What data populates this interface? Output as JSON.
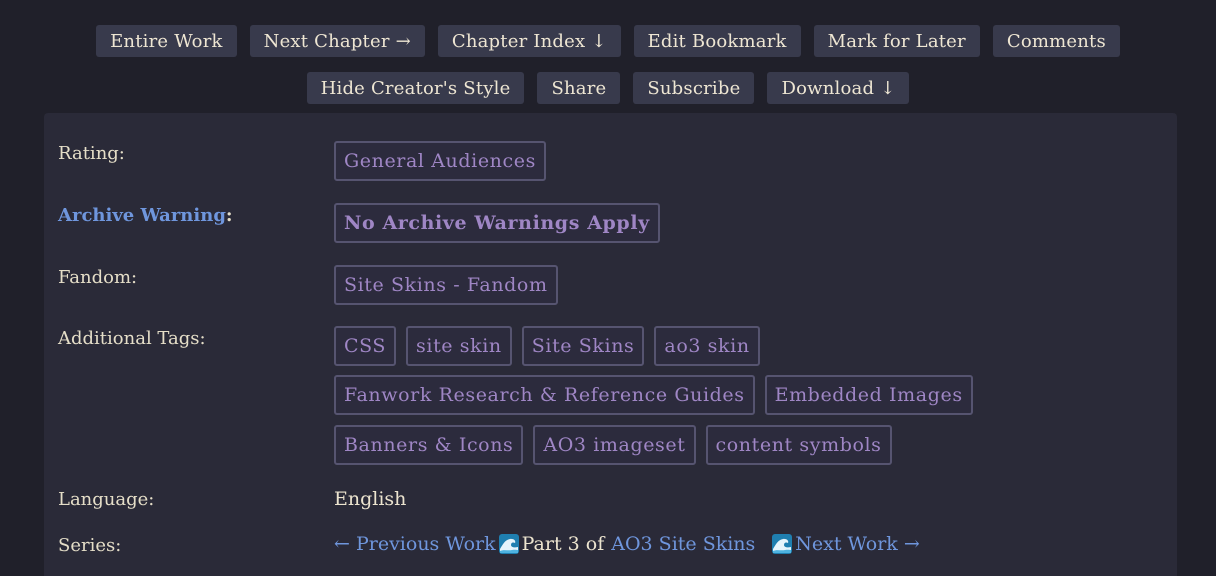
{
  "actions": {
    "row1": [
      {
        "label": "Entire Work"
      },
      {
        "label": "Next Chapter →"
      },
      {
        "label": "Chapter Index ↓"
      },
      {
        "label": "Edit Bookmark"
      },
      {
        "label": "Mark for Later"
      },
      {
        "label": "Comments"
      }
    ],
    "row2": [
      {
        "label": "Hide Creator's Style"
      },
      {
        "label": "Share"
      },
      {
        "label": "Subscribe"
      },
      {
        "label": "Download ↓"
      }
    ]
  },
  "meta": {
    "rating": {
      "label": "Rating:",
      "tags": [
        "General Audiences"
      ]
    },
    "warning": {
      "label": "Archive Warning",
      "colon": ":",
      "tags": [
        "No Archive Warnings Apply"
      ]
    },
    "fandom": {
      "label": "Fandom:",
      "tags": [
        "Site Skins - Fandom"
      ]
    },
    "additional": {
      "label": "Additional Tags:",
      "tags_row1": [
        "CSS",
        "site skin",
        "Site Skins",
        "ao3 skin"
      ],
      "tags_row2": [
        "Fanwork Research & Reference Guides",
        "Embedded Images"
      ],
      "tags_row3": [
        "Banners & Icons",
        "AO3 imageset",
        "content symbols"
      ]
    },
    "language": {
      "label": "Language:",
      "value": "English"
    },
    "series": {
      "label": "Series:",
      "previous": "← Previous Work",
      "part_text": "Part 3 of",
      "series_name": "AO3 Site Skins",
      "next": "Next Work →",
      "icon": "wave-icon"
    }
  },
  "colors": {
    "background": "#20202a",
    "panel": "#2a2a38",
    "button": "#383a4c",
    "tag_text": "#9f86c5",
    "link": "#6f96dd",
    "text": "#ece4cf"
  }
}
